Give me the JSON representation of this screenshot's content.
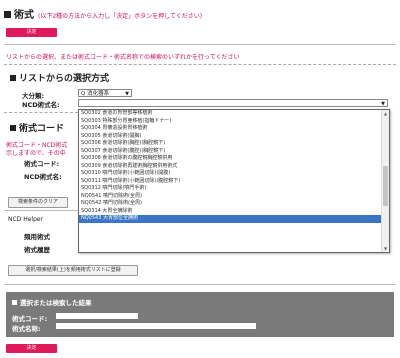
{
  "header": {
    "title": "術式",
    "note": "(以下2種の方法から入力し「決定」ボタンを押してください)",
    "decide_top": "決定"
  },
  "hint": "リストからの選択、または術式コード・術式名称での検索のいずれかを行ってください",
  "list_section": {
    "title": "リストからの選択方式",
    "category_label": "大分類:",
    "category_value": "Q 消化器系",
    "ncd_label": "NCD術式名:",
    "ncd_value": ""
  },
  "dropdown": {
    "items": [
      "SQ0302 食道の胃管部等移植術",
      "SQ0303 特殊部分胃亜移植(指輪ドナー)",
      "SQ0304 胃瘻造設術胃移植術",
      "SQ0305 食道切除術(開胸)",
      "SQ0306 食道切除術(胸腔)(胸腔鏡下)",
      "SQ0307 食道切除術(腹腔)(胸腔鏡下)",
      "SQ0308 食道切除術の腹腔鏡胸腔鏡併用",
      "SQ0309 食道切除術再建術胸腔鏡併用術式",
      "SQ0310 噴門切除術(小範囲切除)(開腹)",
      "SQ0311 噴門切除術(小範囲切除)(腹腔鏡下)",
      "SQ0312 噴門切除(噴門手術)",
      "NQ0541 噴門切除術(全周)",
      "NQ0542 噴門切除術(全周)",
      "SQ0314 大胃全摘除術",
      "NQ0543 大胃部位全摘術"
    ],
    "selected_index": 14
  },
  "code_section": {
    "title": "術式コード",
    "pink_line1": "術式コード・NCD術式",
    "pink_line2": "示しますので、その中",
    "code_label": "術式コード:",
    "name_label": "NCD術式名:"
  },
  "clear_button": "検索条件のクリア",
  "helper": {
    "title": "NCD Helper",
    "usage_label": "頻用術式",
    "history_label": "術式履歴"
  },
  "select_button": "選択/検索結果(上)を頻用術式リストに登録",
  "result": {
    "title": "選択または検索した結果",
    "code_label": "術式コード:",
    "name_label": "術式名称:"
  },
  "decide_bottom": "決定"
}
